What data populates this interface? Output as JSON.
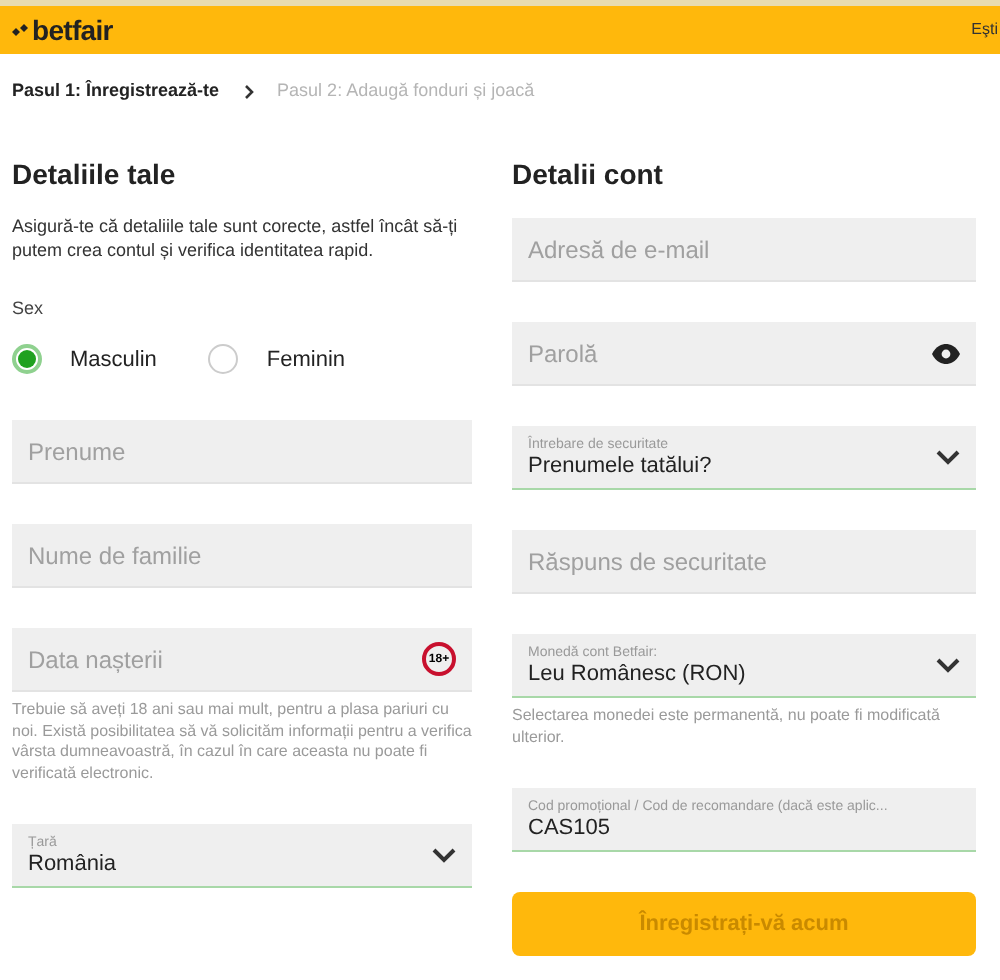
{
  "header": {
    "logo": "betfair",
    "user_text": "Eşti"
  },
  "steps": [
    {
      "label": "Pasul 1: Înregistrează-te",
      "selected": true
    },
    {
      "label": "Pasul 2: Adaugă fonduri și joacă",
      "selected": false
    }
  ],
  "left": {
    "title": "Detaliile tale",
    "intro": "Asigură-te că detaliile tale sunt corecte, astfel încât să-ți putem crea contul și verifica identitatea rapid.",
    "sex": {
      "label": "Sex",
      "options": [
        {
          "label": "Masculin",
          "selected": true
        },
        {
          "label": "Feminin",
          "selected": false
        }
      ]
    },
    "items": [
      {
        "kind": "text",
        "placeholder": "Prenume"
      },
      {
        "kind": "text",
        "placeholder": "Nume de familie"
      },
      {
        "kind": "date",
        "placeholder": "Data nașterii",
        "badge": "18+"
      },
      {
        "kind": "note",
        "text": "Trebuie să aveți 18 ani sau mai mult, pentru a plasa pariuri cu noi. Există posibilitatea să vă solicităm informații pentru a verifica vârsta dumneavoastră, în cazul în care aceasta nu poate fi verificată electronic."
      },
      {
        "kind": "select",
        "label": "Țară",
        "value": "România"
      }
    ]
  },
  "right": {
    "title": "Detalii cont",
    "items": [
      {
        "kind": "text",
        "placeholder": "Adresă de e-mail"
      },
      {
        "kind": "password",
        "placeholder": "Parolă"
      },
      {
        "kind": "select",
        "label": "Întrebare de securitate",
        "value": "Prenumele tatălui?"
      },
      {
        "kind": "text",
        "placeholder": "Răspuns de securitate"
      },
      {
        "kind": "select",
        "label": "Monedă cont Betfair:",
        "value": "Leu Românesc (RON)"
      },
      {
        "kind": "note",
        "text": "Selectarea monedei este permanentă, nu poate fi modificată ulterior."
      },
      {
        "kind": "filled",
        "label": "Cod promoțional / Cod de recomandare (dacă este aplic...",
        "value": "CAS105"
      }
    ],
    "button": "Înregistrați-vă acum"
  }
}
